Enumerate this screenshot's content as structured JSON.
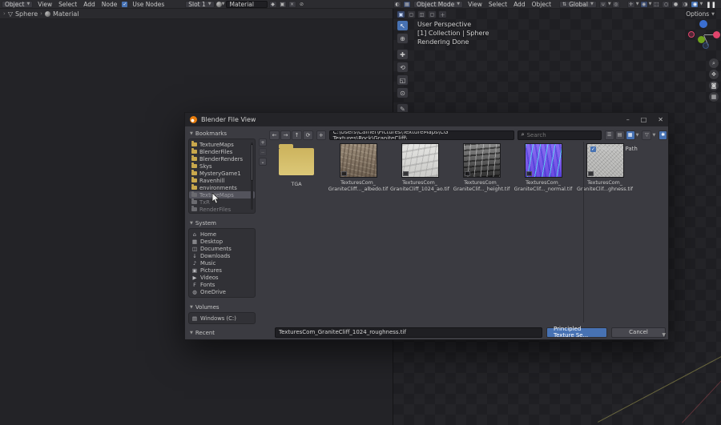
{
  "topbar_left": {
    "object_menu": "Object",
    "view": "View",
    "select": "Select",
    "add": "Add",
    "node": "Node",
    "use_nodes": "Use Nodes",
    "check": "✓",
    "slot": "Slot 1",
    "material_name": "Material"
  },
  "breadcrumb": {
    "object": "Sphere",
    "material": "Material",
    "sep": "›",
    "obj_icon": "▽"
  },
  "topbar_right": {
    "mode": "Object Mode",
    "view": "View",
    "select": "Select",
    "add": "Add",
    "object": "Object",
    "orientation": "Global",
    "options": "Options",
    "pause": "❚❚"
  },
  "viewport": {
    "info_line1": "User Perspective",
    "info_line2": "[1] Collection | Sphere",
    "info_line3": "Rendering Done"
  },
  "dialog": {
    "title": "Blender File View",
    "window_buttons": {
      "minimize": "–",
      "maximize": "□",
      "close": "✕"
    },
    "nav": {
      "back": "←",
      "forward": "→",
      "up": "↑",
      "refresh": "⟳",
      "new_folder": "+"
    },
    "path": "C:\\Users\\Camer\\Pictures\\TextureMaps\\CG Textures\\Rock\\GraniteCliff\\",
    "search_placeholder": "Search",
    "search_icon": "⌕",
    "display_icons": {
      "vlist": "☰",
      "hlist": "▤",
      "grid": "▦",
      "filter": "▽",
      "gear": "✱"
    },
    "relative_path": "Relative Path",
    "check": "✓",
    "filename": "TexturesCom_GraniteCliff_1024_roughness.tif",
    "accept": "Principled Texture Se...",
    "cancel": "Cancel",
    "sections": {
      "bookmarks": "Bookmarks",
      "system": "System",
      "volumes": "Volumes",
      "recent": "Recent"
    },
    "bookmarks": [
      "TextureMaps",
      "BlenderFiles",
      "BlenderRenders",
      "Skys",
      "MysteryGame1",
      "Ravenhill",
      "environments"
    ],
    "bookmarks_dimmed": [
      "TextureMaps",
      "TxR",
      "RenderFiles"
    ],
    "minibtns": {
      "add": "+",
      "remove": "−",
      "more": "⌄"
    },
    "system": [
      {
        "label": "Home",
        "icon": "⌂"
      },
      {
        "label": "Desktop",
        "icon": "▦"
      },
      {
        "label": "Documents",
        "icon": "◫"
      },
      {
        "label": "Downloads",
        "icon": "↓"
      },
      {
        "label": "Music",
        "icon": "♪"
      },
      {
        "label": "Pictures",
        "icon": "▣"
      },
      {
        "label": "Videos",
        "icon": "▶"
      },
      {
        "label": "Fonts",
        "icon": "F"
      },
      {
        "label": "OneDrive",
        "icon": "◍"
      }
    ],
    "volumes": [
      {
        "label": "Windows (C:)",
        "icon": "▤"
      }
    ],
    "files": [
      {
        "line1": "TGA",
        "line2": ""
      },
      {
        "line1": "TexturesCom_",
        "line2": "GraniteCliff..._albedo.tif"
      },
      {
        "line1": "TexturesCom_",
        "line2": "GraniteCliff_1024_ao.tif"
      },
      {
        "line1": "TexturesCom_",
        "line2": "GraniteClif..._height.tif"
      },
      {
        "line1": "TexturesCom_",
        "line2": "GraniteClif..._normal.tif"
      },
      {
        "line1": "TexturesCom_",
        "line2": "GraniteClif...ghness.tif"
      }
    ]
  },
  "tools": {
    "select": "↖",
    "cursor": "⊕",
    "move": "✚",
    "rotate": "⟲",
    "scale": "◱",
    "transform": "⊙",
    "annotate": "✎"
  },
  "colors": {
    "accent": "#4772b3",
    "axis_x": "#e0446c",
    "axis_y": "#6fa21c",
    "axis_z": "#3b6fd0",
    "folder": "#d0b85f"
  }
}
